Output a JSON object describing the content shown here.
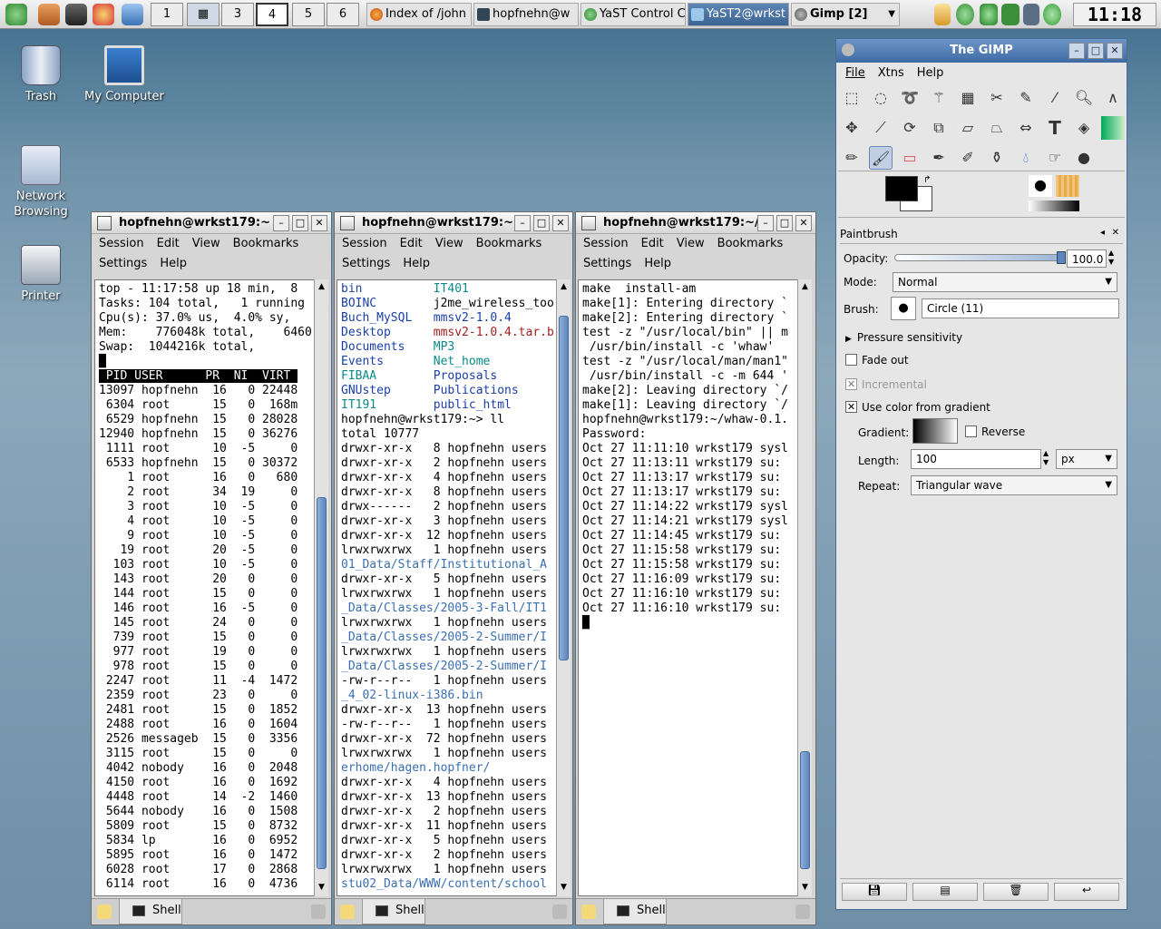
{
  "panel": {
    "pagers": [
      "1",
      "3",
      "4",
      "5",
      "6"
    ],
    "current_pager": "4",
    "tasks": [
      "Index of /john",
      "hopfnehn@w",
      "YaST Control C",
      "YaST2@wrkst",
      "Gimp [2]"
    ],
    "clock": "11:18"
  },
  "desktop": {
    "icons": [
      "Trash",
      "My Computer",
      "Network Browsing",
      "Printer"
    ]
  },
  "terminal_menus": {
    "row1": [
      "Session",
      "Edit",
      "View",
      "Bookmarks"
    ],
    "row2": [
      "Settings",
      "Help"
    ],
    "tab": "Shell"
  },
  "term1": {
    "title": "hopfnehn@wrkst179:~ ·",
    "header": [
      "top - 11:17:58 up 18 min,  8",
      "Tasks: 104 total,   1 running",
      "Cpu(s): 37.0% us,  4.0% sy,",
      "Mem:    776048k total,    6460",
      "Swap:  1044216k total,"
    ],
    "columns": " PID USER      PR  NI  VIRT ",
    "rows": [
      "13097 hopfnehn  16   0 22448",
      "6304 root      15   0  168m",
      "6529 hopfnehn  15   0 28028",
      "12940 hopfnehn  15   0 36276",
      "1111 root      10  -5     0",
      "6533 hopfnehn  15   0 30372",
      "1 root      16   0   680",
      "2 root      34  19     0",
      "3 root      10  -5     0",
      "4 root      10  -5     0",
      "9 root      10  -5     0",
      "19 root      20  -5     0",
      "103 root      10  -5     0",
      "143 root      20   0     0",
      "144 root      15   0     0",
      "146 root      16  -5     0",
      "145 root      24   0     0",
      "739 root      15   0     0",
      "977 root      19   0     0",
      "978 root      15   0     0",
      "2247 root      11  -4  1472",
      "2359 root      23   0     0",
      "2481 root      15   0  1852",
      "2488 root      16   0  1604",
      "2526 messageb  15   0  3356",
      "3115 root      15   0     0",
      "4042 nobody    16   0  2048",
      "4150 root      16   0  1692",
      "4448 root      14  -2  1460",
      "5644 nobody    16   0  1508",
      "5809 root      15   0  8732",
      "5834 lp        16   0  6952",
      "5895 root      16   0  1472",
      "6028 root      17   0  2868",
      "6114 root      16   0  4736"
    ]
  },
  "term2": {
    "title": "hopfnehn@wrkst179:~ ·",
    "ls_left": [
      "bin",
      "BOINC",
      "Buch_MySQL",
      "Desktop",
      "Documents",
      "Events",
      "FIBAA",
      "GNUstep",
      "IT191"
    ],
    "ls_right": [
      "IT401",
      "j2me_wireless_too",
      "mmsv2-1.0.4",
      "mmsv2-1.0.4.tar.b",
      "MP3",
      "Net_home",
      "Proposals",
      "Publications",
      "public_html"
    ],
    "prompt": "hopfnehn@wrkst179:~> ll",
    "total": "total 10777",
    "ll": [
      "drwxr-xr-x   8 hopfnehn users",
      "drwxr-xr-x   2 hopfnehn users",
      "drwxr-xr-x   4 hopfnehn users",
      "drwxr-xr-x   8 hopfnehn users",
      "drwx------   2 hopfnehn users",
      "drwxr-xr-x   3 hopfnehn users",
      "drwxr-xr-x  12 hopfnehn users",
      "lrwxrwxrwx   1 hopfnehn users",
      "01_Data/Staff/Institutional_A",
      "drwxr-xr-x   5 hopfnehn users",
      "lrwxrwxrwx   1 hopfnehn users",
      "_Data/Classes/2005-3-Fall/IT1",
      "lrwxrwxrwx   1 hopfnehn users",
      "_Data/Classes/2005-2-Summer/I",
      "lrwxrwxrwx   1 hopfnehn users",
      "_Data/Classes/2005-2-Summer/I",
      "-rw-r--r--   1 hopfnehn users",
      "_4_02-linux-i386.bin",
      "drwxr-xr-x  13 hopfnehn users",
      "-rw-r--r--   1 hopfnehn users",
      "drwxr-xr-x  72 hopfnehn users",
      "lrwxrwxrwx   1 hopfnehn users",
      "erhome/hagen.hopfner/",
      "drwxr-xr-x   4 hopfnehn users",
      "drwxr-xr-x  13 hopfnehn users",
      "drwxr-xr-x   2 hopfnehn users",
      "drwxr-xr-x  11 hopfnehn users",
      "drwxr-xr-x   5 hopfnehn users",
      "drwxr-xr-x   2 hopfnehn users",
      "lrwxrwxrwx   1 hopfnehn users",
      "stu02_Data/WWW/content/school"
    ]
  },
  "term3": {
    "title": "hopfnehn@wrkst179:~/",
    "lines": [
      "make  install-am",
      "make[1]: Entering directory `",
      "make[2]: Entering directory `",
      "test -z \"/usr/local/bin\" || m",
      " /usr/bin/install -c 'whaw'",
      "test -z \"/usr/local/man/man1\"",
      " /usr/bin/install -c -m 644 '",
      "make[2]: Leaving directory `/",
      "make[1]: Leaving directory `/",
      "hopfnehn@wrkst179:~/whaw-0.1.",
      "Password:",
      "Oct 27 11:11:10 wrkst179 sysl",
      "Oct 27 11:13:11 wrkst179 su:",
      "Oct 27 11:13:17 wrkst179 su:",
      "Oct 27 11:13:17 wrkst179 su:",
      "Oct 27 11:14:22 wrkst179 sysl",
      "Oct 27 11:14:21 wrkst179 sysl",
      "Oct 27 11:14:45 wrkst179 su:",
      "Oct 27 11:15:58 wrkst179 su:",
      "Oct 27 11:15:58 wrkst179 su:",
      "Oct 27 11:16:09 wrkst179 su:",
      "Oct 27 11:16:10 wrkst179 su:",
      "Oct 27 11:16:10 wrkst179 su:"
    ]
  },
  "gimp": {
    "title": "The GIMP",
    "menu": [
      "File",
      "Xtns",
      "Help"
    ],
    "tool_options_title": "Paintbrush",
    "opacity_label": "Opacity:",
    "opacity_value": "100.0",
    "mode_label": "Mode:",
    "mode_value": "Normal",
    "brush_label": "Brush:",
    "brush_value": "Circle (11)",
    "pressure": "Pressure sensitivity",
    "fade_out": "Fade out",
    "incremental": "Incremental",
    "use_color": "Use color from gradient",
    "gradient_label": "Gradient:",
    "reverse": "Reverse",
    "length_label": "Length:",
    "length_value": "100",
    "length_unit": "px",
    "repeat_label": "Repeat:",
    "repeat_value": "Triangular wave"
  },
  "colors": {
    "accent": "#3e6aa4",
    "terminal_bg": "#ffffff"
  }
}
